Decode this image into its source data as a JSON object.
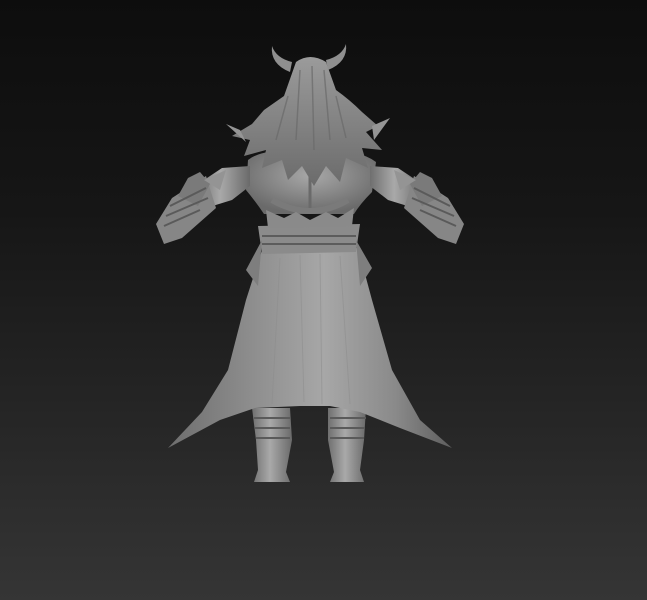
{
  "viewport": {
    "kind": "3d-sculpt-viewport",
    "background_top": "#0d0d0d",
    "background_bottom": "#353535",
    "model_material_color": "#9a9a9a",
    "model_view": "back"
  }
}
